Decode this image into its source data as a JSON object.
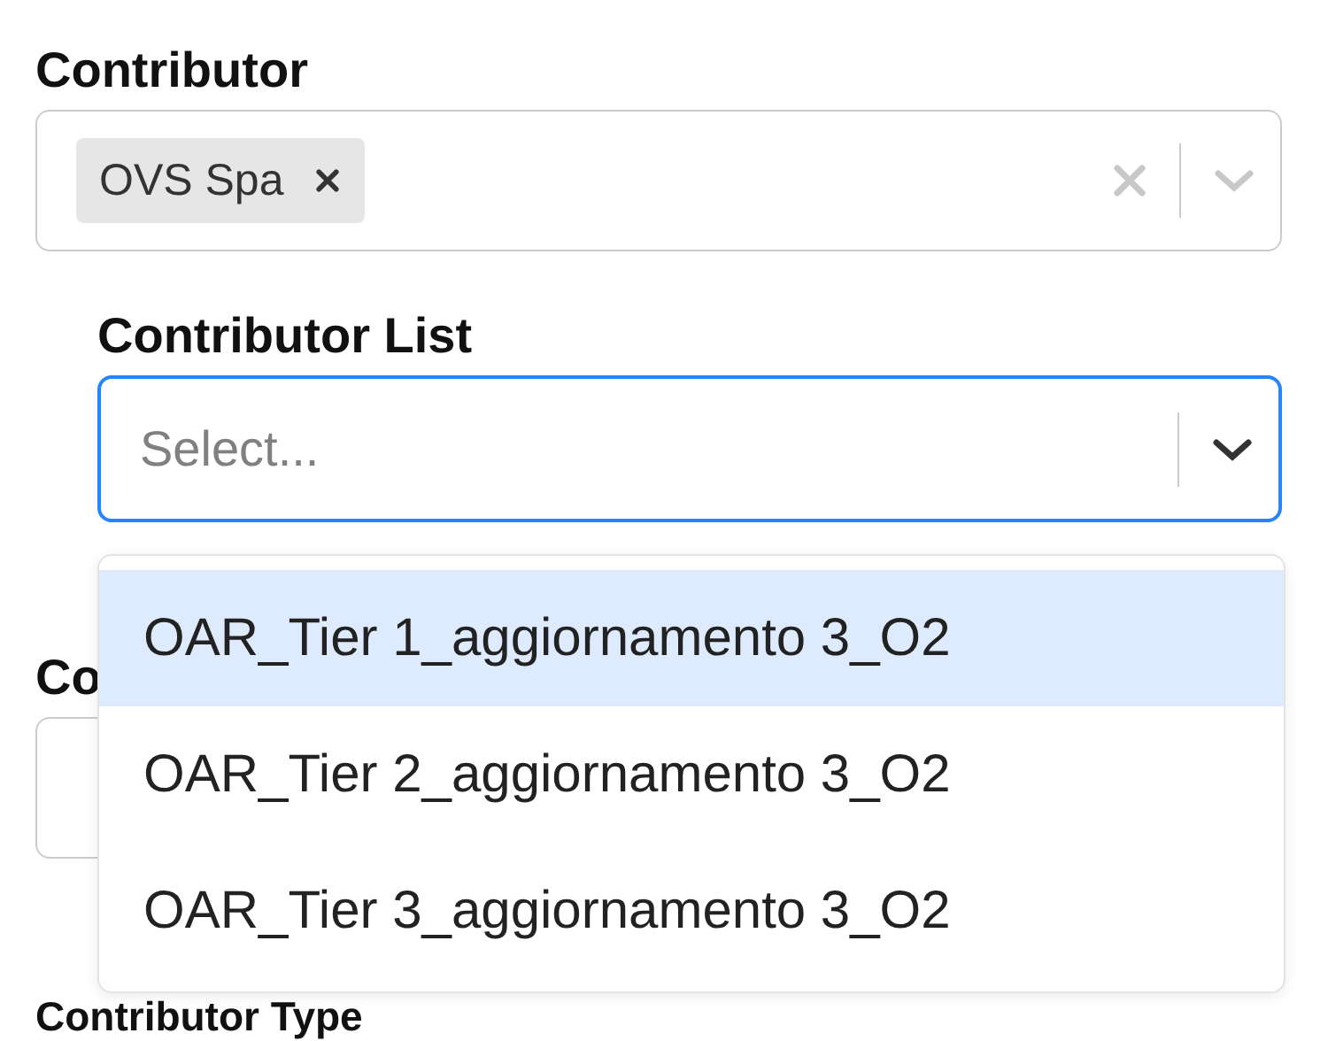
{
  "contributor": {
    "label": "Contributor",
    "tags": [
      {
        "label": "OVS Spa"
      }
    ]
  },
  "contributor_list": {
    "label": "Contributor List",
    "placeholder": "Select...",
    "focused": true,
    "menu_open": true,
    "options": [
      {
        "label": "OAR_Tier 1_aggiornamento 3_O2",
        "selected": true
      },
      {
        "label": "OAR_Tier 2_aggiornamento 3_O2",
        "selected": false
      },
      {
        "label": "OAR_Tier 3_aggiornamento 3_O2",
        "selected": false
      }
    ]
  },
  "hidden_field": {
    "label": "Co"
  },
  "contributor_type": {
    "label": "Contributor Type"
  }
}
